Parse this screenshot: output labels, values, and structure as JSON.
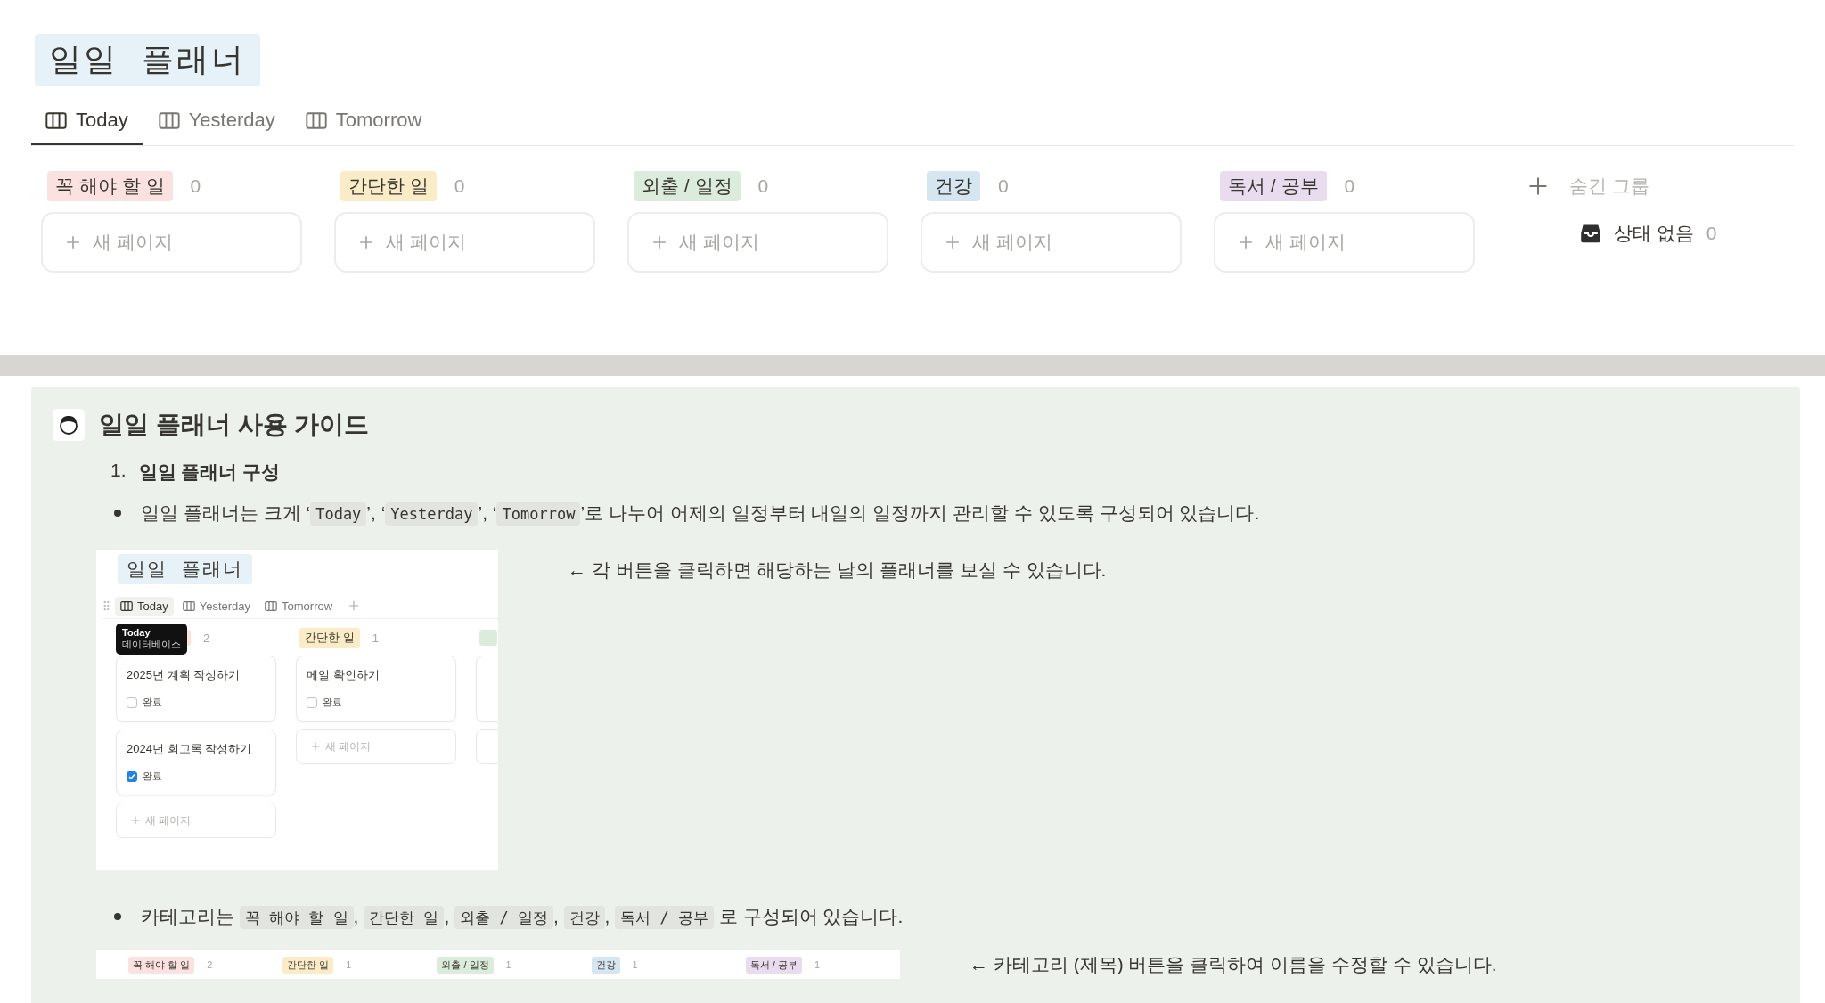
{
  "title": "일일  플래너",
  "tabs": [
    {
      "label": "Today",
      "selected": true
    },
    {
      "label": "Yesterday",
      "selected": false
    },
    {
      "label": "Tomorrow",
      "selected": false
    }
  ],
  "columns": [
    {
      "label": "꼭 해야 할 일",
      "color": "#fbe2e1",
      "count": "0",
      "add_label": "새 페이지"
    },
    {
      "label": "간단한 일",
      "color": "#fbecc8",
      "count": "0",
      "add_label": "새 페이지"
    },
    {
      "label": "외출 / 일정",
      "color": "#dcecdc",
      "count": "0",
      "add_label": "새 페이지"
    },
    {
      "label": "건강",
      "color": "#d5e6f1",
      "count": "0",
      "add_label": "새 페이지"
    },
    {
      "label": "독서 / 공부",
      "color": "#e8dcee",
      "count": "0",
      "add_label": "새 페이지"
    }
  ],
  "hidden_group": {
    "label": "숨긴 그룹",
    "items": [
      {
        "label": "상태 없음",
        "count": "0"
      }
    ]
  },
  "guide": {
    "title": "일일 플래너 사용 가이드",
    "heading": {
      "number": "1.",
      "text": "일일 플래너 구성"
    },
    "bullet_1": [
      {
        "kind": "text",
        "text": "일일 플래너는 크게 ‘"
      },
      {
        "kind": "code",
        "text": "Today"
      },
      {
        "kind": "text",
        "text": "’, ‘"
      },
      {
        "kind": "code",
        "text": "Yesterday"
      },
      {
        "kind": "text",
        "text": "’, ‘"
      },
      {
        "kind": "code",
        "text": "Tomorrow"
      },
      {
        "kind": "text",
        "text": "’로 나누어 어제의 일정부터 내일의 일정까지 관리할 수 있도록 구성되어 있습니다."
      }
    ],
    "inset": {
      "title": "일일  플래너",
      "tabs": [
        {
          "label": "Today",
          "selected": true
        },
        {
          "label": "Yesterday",
          "selected": false
        },
        {
          "label": "Tomorrow",
          "selected": false
        }
      ],
      "tooltip": {
        "title": "Today",
        "subtitle": "데이터베이스"
      },
      "columns": [
        {
          "color": "#fbe2e1",
          "count": "2",
          "cards": [
            {
              "title": "2025년 계획 작성하기",
              "checkbox_label": "완료",
              "checked": false
            },
            {
              "title": "2024년 회고록 작성하기",
              "checkbox_label": "완료",
              "checked": true
            }
          ],
          "add_label": "새 페이지"
        },
        {
          "label": "간단한 일",
          "color": "#fbecc8",
          "count": "1",
          "cards": [
            {
              "title": "메일 확인하기",
              "checkbox_label": "완료",
              "checked": false
            }
          ],
          "add_label": "새 페이지"
        }
      ]
    },
    "note_1": "← 각 버튼을 클릭하면 해당하는 날의 플래너를 보실 수 있습니다.",
    "bullet_2": [
      {
        "kind": "text",
        "text": "카테고리는 "
      },
      {
        "kind": "code",
        "text": "꼭 해야 할 일"
      },
      {
        "kind": "text",
        "text": ", "
      },
      {
        "kind": "code",
        "text": "간단한 일"
      },
      {
        "kind": "text",
        "text": ", "
      },
      {
        "kind": "code",
        "text": "외출 / 일정"
      },
      {
        "kind": "text",
        "text": ", "
      },
      {
        "kind": "code",
        "text": "건강"
      },
      {
        "kind": "text",
        "text": ", "
      },
      {
        "kind": "code",
        "text": "독서 / 공부"
      },
      {
        "kind": "text",
        "text": " 로 구성되어 있습니다."
      }
    ],
    "strip": [
      {
        "label": "꼭 해야 할 일",
        "color": "#fbe2e1",
        "count": "2"
      },
      {
        "label": "간단한 일",
        "color": "#fbecc8",
        "count": "1"
      },
      {
        "label": "외출 / 일정",
        "color": "#dcecdc",
        "count": "1"
      },
      {
        "label": "건강",
        "color": "#d5e6f1",
        "count": "1"
      },
      {
        "label": "독서 / 공부",
        "color": "#e8dcee",
        "count": "1"
      }
    ],
    "note_2": "← 카테고리 (제목) 버튼을 클릭하여 이름을 수정할 수 있습니다."
  }
}
